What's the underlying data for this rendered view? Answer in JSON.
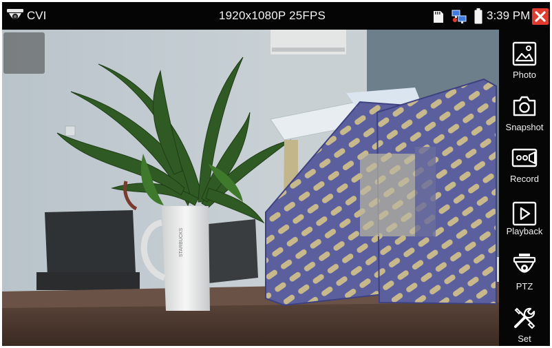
{
  "topbar": {
    "app_name": "CVI",
    "resolution": "1920x1080P 25FPS",
    "time": "3:39 PM"
  },
  "icons": {
    "logo": "dome-camera-icon",
    "storage": "sd-card-icon",
    "network": "network-icon",
    "battery": "battery-icon",
    "close": "close-icon"
  },
  "colors": {
    "close_button": "#e23b2e",
    "panel_background": "#060606",
    "icon_stroke": "#ffffff"
  },
  "sidebar": {
    "items": [
      {
        "label": "Photo",
        "icon": "image-icon"
      },
      {
        "label": "Snapshot",
        "icon": "camera-icon"
      },
      {
        "label": "Record",
        "icon": "video-record-icon"
      },
      {
        "label": "Playback",
        "icon": "play-icon"
      },
      {
        "label": "PTZ",
        "icon": "ptz-dome-icon"
      },
      {
        "label": "Set",
        "icon": "settings-tools-icon"
      }
    ]
  }
}
